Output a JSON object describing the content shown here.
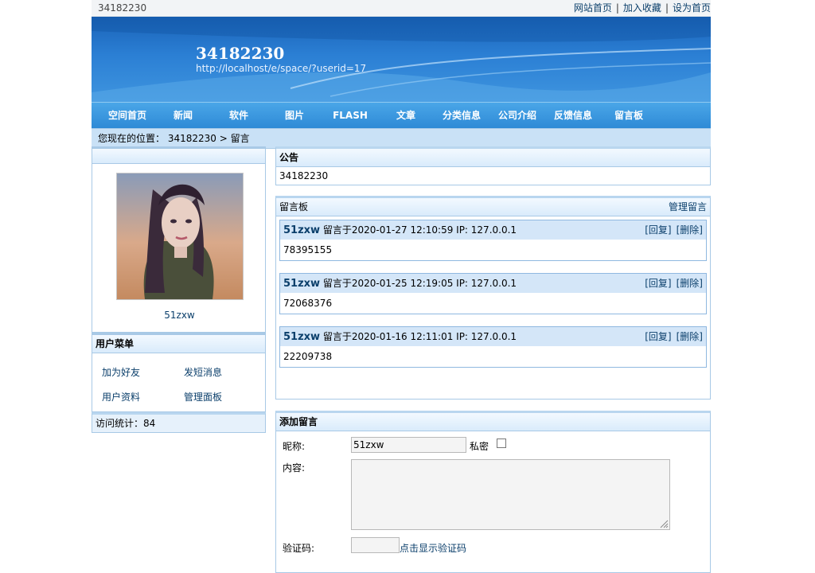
{
  "topbar": {
    "site_id": "34182230",
    "links": [
      "网站首页",
      "加入收藏",
      "设为首页"
    ],
    "separator": "|"
  },
  "banner": {
    "title": "34182230",
    "url": "http://localhost/e/space/?userid=17"
  },
  "nav": [
    "空间首页",
    "新闻",
    "软件",
    "图片",
    "FLASH",
    "文章",
    "分类信息",
    "公司介绍",
    "反馈信息",
    "留言板"
  ],
  "breadcrumb": "您现在的位置： 34182230 > 留言",
  "sidebar": {
    "username": "51zxw",
    "menu_title": "用户菜单",
    "menu": [
      "加为好友",
      "发短消息",
      "用户资料",
      "管理面板"
    ],
    "stats": "访问统计：84"
  },
  "notice": {
    "title": "公告",
    "content": "34182230"
  },
  "guestbook": {
    "title": "留言板",
    "manage": "管理留言",
    "messages": [
      {
        "author": "51zxw",
        "meta": "留言于2020-01-27 12:10:59 IP: 127.0.0.1",
        "reply": "[回复]",
        "delete": "[删除]",
        "content": "78395155"
      },
      {
        "author": "51zxw",
        "meta": "留言于2020-01-25 12:19:05 IP: 127.0.0.1",
        "reply": "[回复]",
        "delete": "[删除]",
        "content": "72068376"
      },
      {
        "author": "51zxw",
        "meta": "留言于2020-01-16 12:11:01 IP: 127.0.0.1",
        "reply": "[回复]",
        "delete": "[删除]",
        "content": "22209738"
      }
    ]
  },
  "form": {
    "title": "添加留言",
    "nickname_label": "昵称:",
    "nickname_value": "51zxw",
    "private_label": "私密",
    "content_label": "内容:",
    "captcha_label": "验证码:",
    "captcha_link": "点击显示验证码"
  },
  "colors": {
    "link": "#0b3f6b",
    "nav_bg": "#2e8ad6",
    "banner_bg": "#1a63b8",
    "box_border": "#a8c9e6",
    "message_header": "#d4e6f8"
  }
}
